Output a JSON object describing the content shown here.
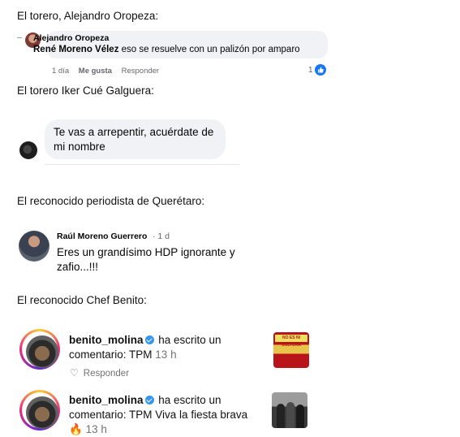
{
  "headings": {
    "h1": "El torero, Alejandro Oropeza:",
    "h2": "El torero Iker Cué Galguera:",
    "h3": "El reconocido periodista de Querétaro:",
    "h4": "El reconocido Chef Benito:"
  },
  "fb_comment": {
    "author": "Alejandro Oropeza",
    "mention": "René Moreno Vélez",
    "text": " eso se resuelve con un palizón por amparo",
    "time": "1 día",
    "like_label": "Me gusta",
    "reply_label": "Responder",
    "reaction_count": "1",
    "reaction_color": "#1877f2"
  },
  "iker_message": {
    "text": "Te vas a arrepentir, acuérdate de mi nombre"
  },
  "raul_comment": {
    "author": "Raúl Moreno Guerrero",
    "time": "· 1 d",
    "text": "Eres un grandísimo HDP ignorante y zafio...!!!"
  },
  "ig_notifications": [
    {
      "user": "benito_molina",
      "action": " ha escrito un comentario: TPM ",
      "time": "13 h",
      "reply_label": "Responder",
      "thumb_banner": "NO ES NI CULTURA"
    },
    {
      "user": "benito_molina",
      "action": " ha escrito un comentario: TPM Viva la fiesta brava",
      "emoji": "🔥",
      "time": "13 h"
    }
  ],
  "colors": {
    "verified": "#3797f0"
  }
}
